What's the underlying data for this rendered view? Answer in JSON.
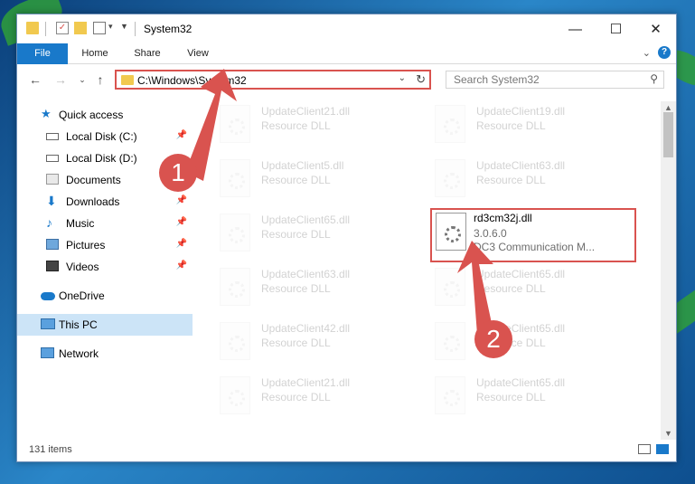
{
  "window": {
    "title": "System32"
  },
  "ribbon": {
    "tabs": [
      "File",
      "Home",
      "Share",
      "View"
    ]
  },
  "address": {
    "path": "C:\\Windows\\System32"
  },
  "search": {
    "placeholder": "Search System32"
  },
  "sidebar": {
    "items": [
      {
        "label": "Quick access",
        "icon": "star-icon",
        "pinned": false
      },
      {
        "label": "Local Disk (C:)",
        "icon": "drive-icon",
        "pinned": true
      },
      {
        "label": "Local Disk (D:)",
        "icon": "drive-icon",
        "pinned": false
      },
      {
        "label": "Documents",
        "icon": "documents-icon",
        "pinned": true
      },
      {
        "label": "Downloads",
        "icon": "download-icon",
        "pinned": true
      },
      {
        "label": "Music",
        "icon": "music-icon",
        "pinned": true
      },
      {
        "label": "Pictures",
        "icon": "pictures-icon",
        "pinned": true
      },
      {
        "label": "Videos",
        "icon": "videos-icon",
        "pinned": true
      },
      {
        "label": "OneDrive",
        "icon": "onedrive-icon",
        "pinned": false
      },
      {
        "label": "This PC",
        "icon": "computer-icon",
        "pinned": false
      },
      {
        "label": "Network",
        "icon": "network-icon",
        "pinned": false
      }
    ]
  },
  "files": {
    "left": [
      {
        "name": "UpdateClient21.dll",
        "type": "Resource DLL"
      },
      {
        "name": "UpdateClient5.dll",
        "type": "Resource DLL"
      },
      {
        "name": "UpdateClient65.dll",
        "type": "Resource DLL"
      },
      {
        "name": "UpdateClient63.dll",
        "type": "Resource DLL"
      },
      {
        "name": "UpdateClient42.dll",
        "type": "Resource DLL"
      },
      {
        "name": "UpdateClient21.dll",
        "type": "Resource DLL"
      }
    ],
    "right": [
      {
        "name": "UpdateClient19.dll",
        "type": "Resource DLL"
      },
      {
        "name": "UpdateClient63.dll",
        "type": "Resource DLL"
      },
      {
        "name": "UpdateClient65.dll",
        "type": "Resource DLL"
      },
      {
        "name": "UpdateClient65.dll",
        "type": "Resource DLL"
      },
      {
        "name": "UpdateClient65.dll",
        "type": "Resource DLL"
      }
    ],
    "highlighted": {
      "name": "rd3cm32j.dll",
      "version": "3.0.6.0",
      "description": "DC3 Communication M..."
    }
  },
  "status": {
    "item_count": "131 items"
  },
  "callouts": [
    "1",
    "2"
  ],
  "colors": {
    "accent": "#1979ca",
    "highlight": "#d9534f"
  }
}
